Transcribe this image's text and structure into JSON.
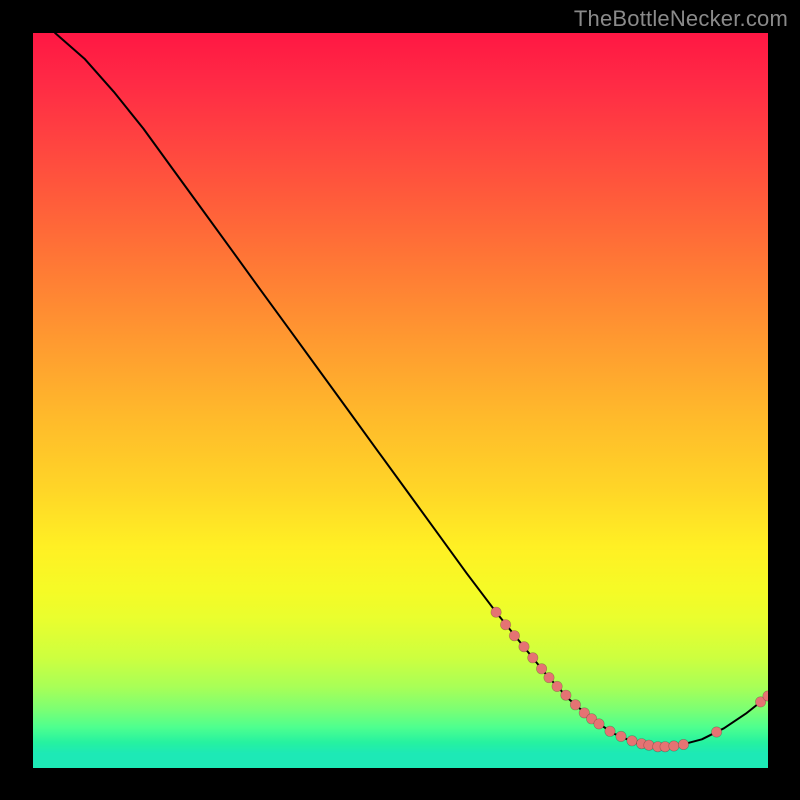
{
  "watermark": "TheBottleNecker.com",
  "chart_data": {
    "type": "line",
    "title": "",
    "xlabel": "",
    "ylabel": "",
    "xlim": [
      0,
      100
    ],
    "ylim": [
      0,
      100
    ],
    "grid": false,
    "curve": [
      {
        "x": 3.0,
        "y": 100.0
      },
      {
        "x": 7.0,
        "y": 96.5
      },
      {
        "x": 11.0,
        "y": 92.0
      },
      {
        "x": 15.0,
        "y": 87.0
      },
      {
        "x": 19.0,
        "y": 81.5
      },
      {
        "x": 23.0,
        "y": 76.0
      },
      {
        "x": 27.0,
        "y": 70.5
      },
      {
        "x": 31.0,
        "y": 65.0
      },
      {
        "x": 35.0,
        "y": 59.5
      },
      {
        "x": 39.0,
        "y": 54.0
      },
      {
        "x": 43.0,
        "y": 48.5
      },
      {
        "x": 47.0,
        "y": 43.0
      },
      {
        "x": 51.0,
        "y": 37.5
      },
      {
        "x": 55.0,
        "y": 32.0
      },
      {
        "x": 59.0,
        "y": 26.5
      },
      {
        "x": 63.0,
        "y": 21.2
      },
      {
        "x": 67.0,
        "y": 16.2
      },
      {
        "x": 70.0,
        "y": 12.5
      },
      {
        "x": 73.0,
        "y": 9.3
      },
      {
        "x": 76.0,
        "y": 6.7
      },
      {
        "x": 79.0,
        "y": 4.7
      },
      {
        "x": 82.0,
        "y": 3.4
      },
      {
        "x": 85.0,
        "y": 2.9
      },
      {
        "x": 88.0,
        "y": 3.1
      },
      {
        "x": 91.0,
        "y": 3.9
      },
      {
        "x": 94.0,
        "y": 5.4
      },
      {
        "x": 97.0,
        "y": 7.4
      },
      {
        "x": 100.0,
        "y": 9.8
      }
    ],
    "markers": [
      {
        "x": 63.0,
        "y": 21.2
      },
      {
        "x": 64.3,
        "y": 19.5
      },
      {
        "x": 65.5,
        "y": 18.0
      },
      {
        "x": 66.8,
        "y": 16.5
      },
      {
        "x": 68.0,
        "y": 15.0
      },
      {
        "x": 69.2,
        "y": 13.5
      },
      {
        "x": 70.2,
        "y": 12.3
      },
      {
        "x": 71.3,
        "y": 11.1
      },
      {
        "x": 72.5,
        "y": 9.9
      },
      {
        "x": 73.8,
        "y": 8.6
      },
      {
        "x": 75.0,
        "y": 7.5
      },
      {
        "x": 76.0,
        "y": 6.7
      },
      {
        "x": 77.0,
        "y": 6.0
      },
      {
        "x": 78.5,
        "y": 5.0
      },
      {
        "x": 80.0,
        "y": 4.3
      },
      {
        "x": 81.5,
        "y": 3.7
      },
      {
        "x": 82.8,
        "y": 3.3
      },
      {
        "x": 83.8,
        "y": 3.1
      },
      {
        "x": 85.0,
        "y": 2.9
      },
      {
        "x": 86.0,
        "y": 2.9
      },
      {
        "x": 87.2,
        "y": 3.0
      },
      {
        "x": 88.5,
        "y": 3.2
      },
      {
        "x": 93.0,
        "y": 4.9
      },
      {
        "x": 99.0,
        "y": 9.0
      },
      {
        "x": 100.0,
        "y": 9.8
      }
    ]
  }
}
